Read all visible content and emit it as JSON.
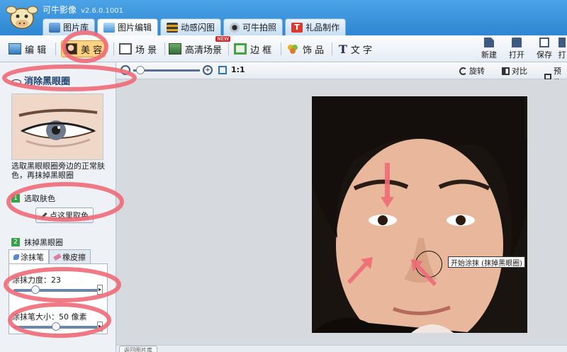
{
  "app": {
    "title": "可牛影像",
    "version": "v2.6.0.1001"
  },
  "tabs": [
    {
      "label": "图片库",
      "active": false
    },
    {
      "label": "图片编辑",
      "active": true
    },
    {
      "label": "动感闪图",
      "active": false
    },
    {
      "label": "可牛拍照",
      "active": false
    },
    {
      "label": "礼品制作",
      "active": false
    }
  ],
  "toolbar": {
    "edit": "编 辑",
    "beauty": "美 容",
    "scene": "场 景",
    "hd_scene": "高清场景",
    "new_badge": "NEW",
    "border": "边 框",
    "decor": "饰 品",
    "text": "文 字",
    "new": "新建",
    "open": "打开",
    "save": "保存",
    "print": "打"
  },
  "canvas_header": {
    "zoom_ratio": "1:1",
    "rotate": "旋转",
    "compare": "对比",
    "preview": "预览"
  },
  "left_panel": {
    "title": "消除黑眼圈",
    "description": "选取黑眼眼圈旁边的正常肤色，再抹掉黑眼圈",
    "step1": {
      "num": "1",
      "label": "选取肤色"
    },
    "pick_button": "点这里取色",
    "step2": {
      "num": "2",
      "label": "抹掉黑眼圈"
    },
    "subtabs": [
      "涂抹笔",
      "橡皮擦"
    ],
    "strength": {
      "label": "涂抹力度：23",
      "value": 23
    },
    "brush_size": {
      "label": "涂抹笔大小：50 像素",
      "value": 50
    }
  },
  "tooltip": "开始涂抹 (抹掉黑眼圈)",
  "status": {
    "back": "返回图片库"
  },
  "colors": {
    "titlebar": "#2f86d2",
    "accent": "#ffd27f",
    "annotation": "#f06b78"
  }
}
